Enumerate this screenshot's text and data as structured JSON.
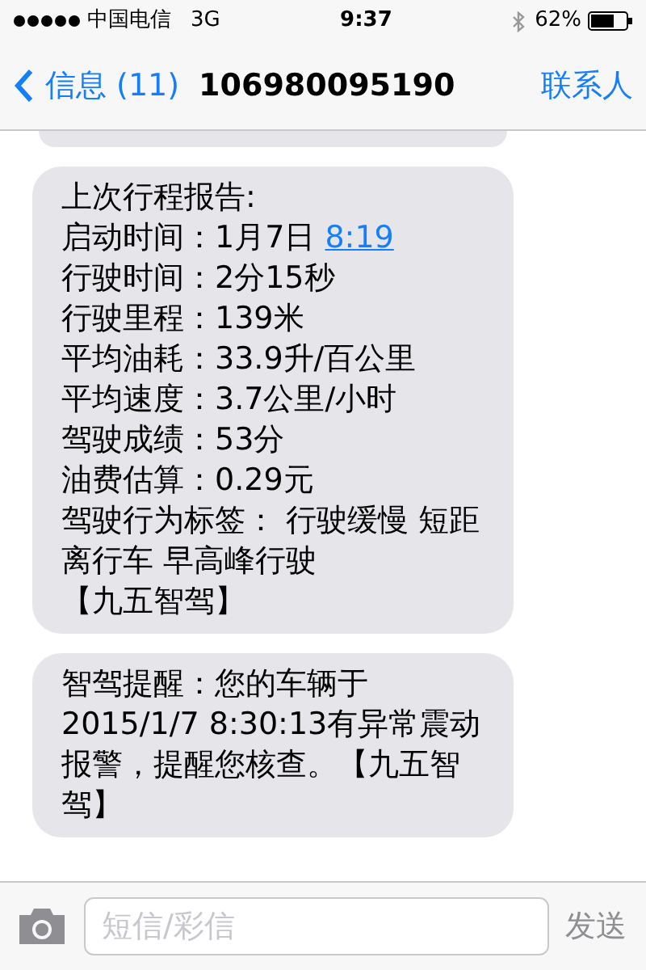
{
  "status_bar": {
    "carrier": "中国电信",
    "network": "3G",
    "time": "9:37",
    "battery": "62%"
  },
  "nav_bar": {
    "back": "信息 (11)",
    "title": "106980095190",
    "action": "联系人"
  },
  "messages": [
    {
      "lines": [
        {
          "text": "上次行程报告:"
        },
        {
          "text": "启动时间：1月7日 ",
          "link": "8:19"
        },
        {
          "text": "行驶时间：2分15秒"
        },
        {
          "text": "行驶里程：139米"
        },
        {
          "text": "平均油耗：33.9升/百公里"
        },
        {
          "text": "平均速度：3.7公里/小时"
        },
        {
          "text": "驾驶成绩：53分"
        },
        {
          "text": "油费估算：0.29元"
        },
        {
          "text": "驾驶行为标签： 行驶缓慢 短距离行车 早高峰行驶"
        },
        {
          "text": "【九五智驾】"
        }
      ]
    },
    {
      "lines": [
        {
          "text": "智驾提醒：您的车辆于2015/1/7 8:30:13有异常震动报警，提醒您核查。【九五智驾】"
        }
      ]
    }
  ],
  "composer": {
    "placeholder": "短信/彩信",
    "send": "发送"
  }
}
